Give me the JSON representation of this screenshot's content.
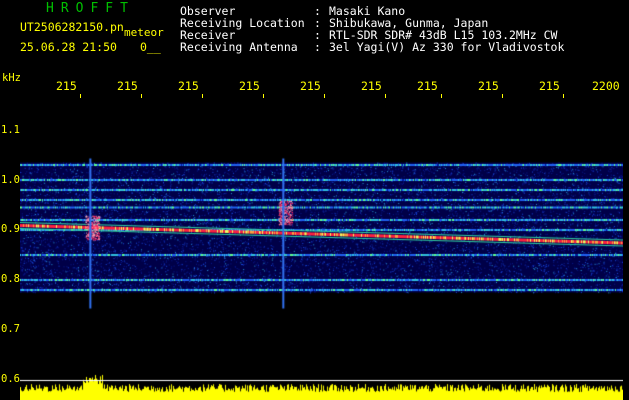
{
  "header": {
    "logo": "HROFFT",
    "filename": "UT2506282150.pn",
    "mode": "meteor",
    "datetime": "25.06.28 21:50",
    "count": "0__"
  },
  "info": [
    {
      "label": "Observer",
      "value": "Masaki Kano"
    },
    {
      "label": "Receiving Location",
      "value": "Shibukawa, Gunma, Japan"
    },
    {
      "label": "Receiver",
      "value": "RTL-SDR SDR# 43dB L15 103.2MHz CW"
    },
    {
      "label": "Receiving Antenna",
      "value": "3el Yagi(V) Az 330 for Vladivostok"
    }
  ],
  "chart_data": {
    "type": "heatmap",
    "ylabel": "kHz",
    "x_tick_labels": [
      "215",
      "215",
      "215",
      "215",
      "215",
      "215",
      "215",
      "215",
      "215",
      "2200"
    ],
    "y_ticks": [
      1.1,
      1.0,
      0.9,
      0.8,
      0.7,
      0.6
    ],
    "y_tick_labels": [
      "1.1",
      "1.0",
      "0.9",
      "0.8",
      "0.7",
      "0.6"
    ],
    "ylim": [
      0.6,
      1.16
    ],
    "carrier_khz_start": 0.91,
    "carrier_khz_end": 0.875,
    "horizontal_bands_khz": [
      1.03,
      1.0,
      0.98,
      0.96,
      0.945,
      0.92,
      0.9,
      0.85,
      0.8,
      0.78
    ],
    "meteor_events": [
      {
        "time_fraction": 0.12,
        "khz": 0.905
      },
      {
        "time_fraction": 0.44,
        "khz": 0.935
      }
    ],
    "colors": {
      "background": "#000030",
      "noise": "#1030d0",
      "signal": "#ff2040",
      "text": "#ffff00"
    }
  }
}
